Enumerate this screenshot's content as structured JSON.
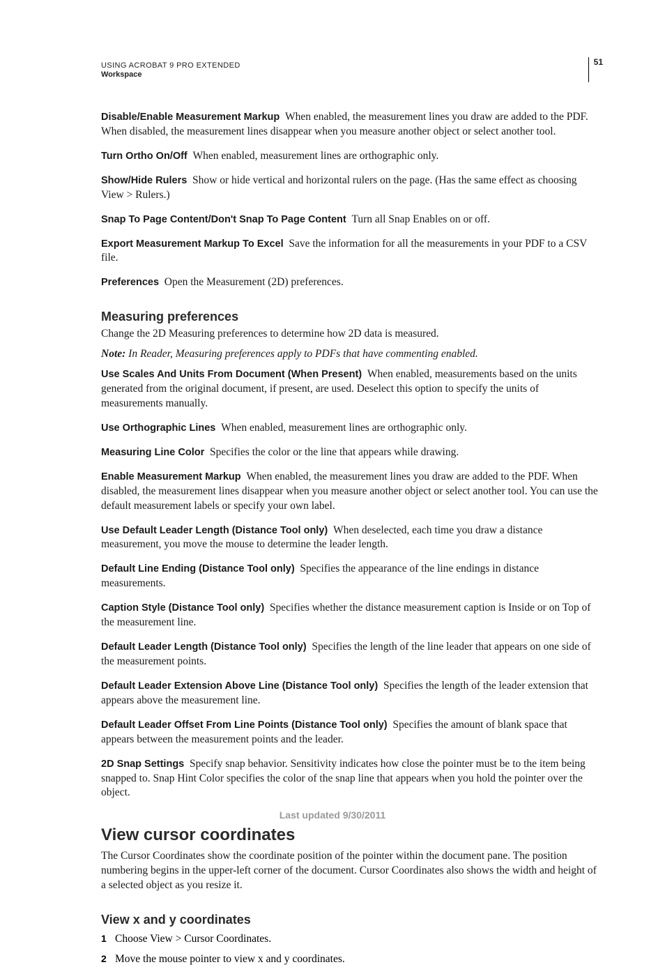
{
  "header": {
    "title": "USING ACROBAT 9 PRO EXTENDED",
    "section": "Workspace",
    "page_number": "51"
  },
  "top_defs": [
    {
      "term": "Disable/Enable Measurement Markup",
      "desc": "When enabled, the measurement lines you draw are added to the PDF. When disabled, the measurement lines disappear when you measure another object or select another tool."
    },
    {
      "term": "Turn Ortho On/Off",
      "desc": "When enabled, measurement lines are orthographic only."
    },
    {
      "term": "Show/Hide Rulers",
      "desc": "Show or hide vertical and horizontal rulers on the page. (Has the same effect as choosing View > Rulers.)"
    },
    {
      "term": "Snap To Page Content/Don't Snap To Page Content",
      "desc": "Turn all Snap Enables on or off."
    },
    {
      "term": "Export Measurement Markup To Excel",
      "desc": "Save the information for all the measurements in your PDF to a CSV file."
    },
    {
      "term": "Preferences",
      "desc": "Open the Measurement (2D) preferences."
    }
  ],
  "measuring": {
    "heading": "Measuring preferences",
    "intro": "Change the 2D Measuring preferences to determine how 2D data is measured.",
    "note_lead": "Note:",
    "note_body": "In Reader, Measuring preferences apply to PDFs that have commenting enabled.",
    "defs": [
      {
        "term": "Use Scales And Units From Document (When Present)",
        "desc": "When enabled, measurements based on the units generated from the original document, if present, are used. Deselect this option to specify the units of measurements manually."
      },
      {
        "term": "Use Orthographic Lines",
        "desc": "When enabled, measurement lines are orthographic only."
      },
      {
        "term": "Measuring Line Color",
        "desc": "Specifies the color or the line that appears while drawing."
      },
      {
        "term": "Enable Measurement Markup",
        "desc": "When enabled, the measurement lines you draw are added to the PDF. When disabled, the measurement lines disappear when you measure another object or select another tool. You can use the default measurement labels or specify your own label."
      },
      {
        "term": "Use Default Leader Length (Distance Tool only)",
        "desc": "When deselected, each time you draw a distance measurement, you move the mouse to determine the leader length."
      },
      {
        "term": "Default Line Ending (Distance Tool only)",
        "desc": "Specifies the appearance of the line endings in distance measurements."
      },
      {
        "term": "Caption Style (Distance Tool only)",
        "desc": "Specifies whether the distance measurement caption is Inside or on Top of the measurement line."
      },
      {
        "term": "Default Leader Length (Distance Tool only)",
        "desc": "Specifies the length of the line leader that appears on one side of the measurement points."
      },
      {
        "term": "Default Leader Extension Above Line (Distance Tool only)",
        "desc": "Specifies the length of the leader extension that appears above the measurement line."
      },
      {
        "term": "Default Leader Offset From Line Points (Distance Tool only)",
        "desc": "Specifies the amount of blank space that appears between the measurement points and the leader."
      },
      {
        "term": "2D Snap Settings",
        "desc": "Specify snap behavior. Sensitivity indicates how close the pointer must be to the item being snapped to. Snap Hint Color specifies the color of the snap line that appears when you hold the pointer over the object."
      }
    ]
  },
  "cursor": {
    "heading": "View cursor coordinates",
    "intro": "The Cursor Coordinates show the coordinate position of the pointer within the document pane. The position numbering begins in the upper-left corner of the document. Cursor Coordinates also shows the width and height of a selected object as you resize it.",
    "sub_heading": "View x and y coordinates",
    "steps": [
      {
        "n": "1",
        "text": "Choose View > Cursor Coordinates."
      },
      {
        "n": "2",
        "text": "Move the mouse pointer to view x and y coordinates."
      }
    ]
  },
  "footer": "Last updated 9/30/2011"
}
